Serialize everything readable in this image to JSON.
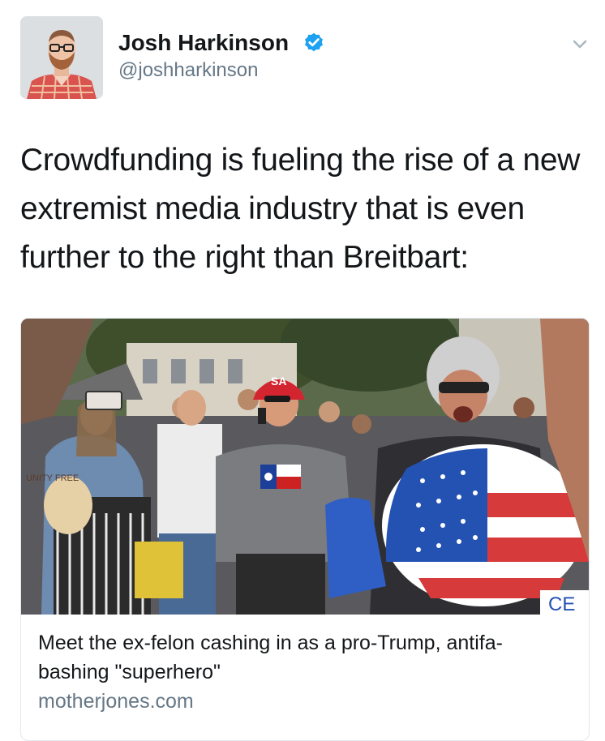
{
  "author": {
    "display_name": "Josh Harkinson",
    "handle": "@joshharkinson",
    "verified": true,
    "avatar": "avatar-photo"
  },
  "menu_icon": "chevron-down-icon",
  "tweet": {
    "text": "Crowdfunding is fueling the rise of a new extremist media industry that is even further to the right than Breitbart:"
  },
  "card": {
    "image": "rally-photo",
    "title": "Meet the ex-felon cashing in as a pro-Trump, antifa-bashing \"superhero\"",
    "domain": "motherjones.com",
    "image_texts": {
      "hat": "SA",
      "shield_corner": "CE",
      "sign": "UNITY FREE"
    }
  },
  "colors": {
    "verified_blue": "#1da1f2",
    "secondary_text": "#657786",
    "border": "#e1e8ed"
  }
}
